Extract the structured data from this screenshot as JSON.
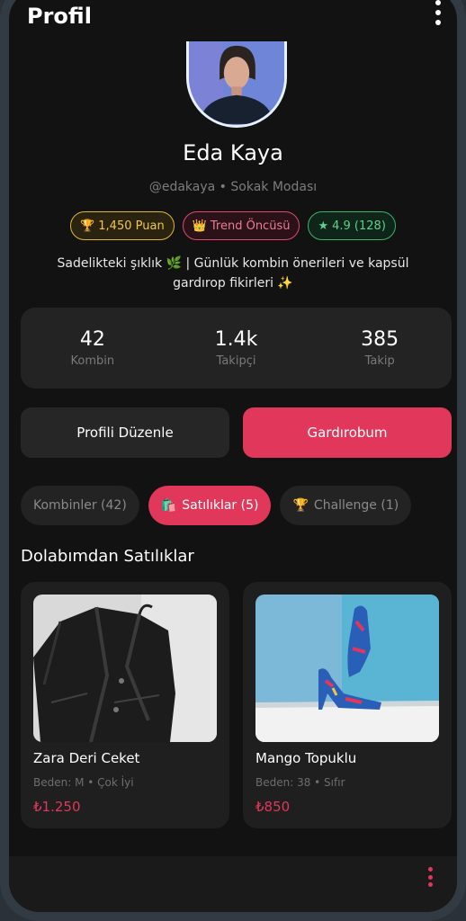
{
  "header": {
    "title": "Profil",
    "menu_icon": "more-vertical-icon"
  },
  "profile": {
    "name": "Eda Kaya",
    "handle": "@edakaya • Sokak Modası",
    "bio_line1": "Sadelikteki şıklık 🌿 | Günlük kombin önerileri ve kapsül",
    "bio_line2": "gardırop fikirleri ✨"
  },
  "badges": [
    {
      "icon": "🏆",
      "label": "1,450 Puan"
    },
    {
      "icon": "👑",
      "label": "Trend Öncüsü"
    },
    {
      "icon": "★",
      "label": "4.9 (128)"
    }
  ],
  "stats": [
    {
      "value": "42",
      "label": "Kombin"
    },
    {
      "value": "1.4k",
      "label": "Takipçi"
    },
    {
      "value": "385",
      "label": "Takip"
    }
  ],
  "actions": {
    "edit_label": "Profili Düzenle",
    "wardrobe_label": "Gardırobum"
  },
  "tabs": [
    {
      "icon": "",
      "label": "Kombinler (42)"
    },
    {
      "icon": "🛍️",
      "label": "Satılıklar (5)"
    },
    {
      "icon": "🏆",
      "label": "Challenge (1)"
    }
  ],
  "section_title": "Dolabımdan Satılıklar",
  "listings": [
    {
      "title": "Zara Deri Ceket",
      "meta": "Beden: M • Çok İyi",
      "price": "₺1.250"
    },
    {
      "title": "Mango Topuklu",
      "meta": "Beden: 38 • Sıfır",
      "price": "₺850"
    }
  ],
  "colors": {
    "accent": "#e0375a",
    "gold": "#e2b531",
    "green": "#3ab36a",
    "background": "#121212"
  }
}
